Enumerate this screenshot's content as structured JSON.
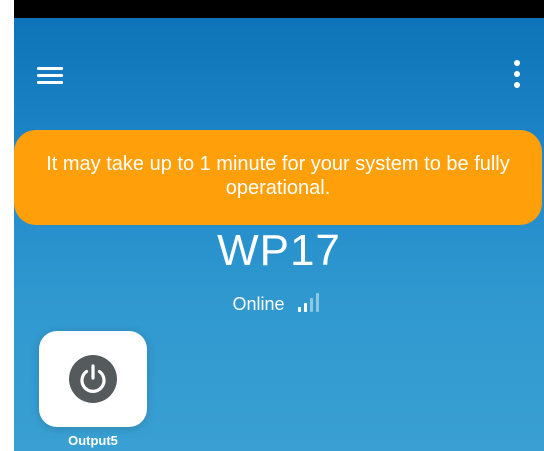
{
  "colors": {
    "background_top": "#0b72b7",
    "background_bottom": "#3aa0d3",
    "toast": "#ff9f0a",
    "power_icon_bg": "#555a5d",
    "signal_active": "#ffffff",
    "signal_inactive": "#8fc6e6"
  },
  "appbar": {
    "menu_icon": "hamburger-menu-icon",
    "overflow_icon": "more-vert-icon"
  },
  "toast": {
    "message": "It may take up to 1 minute for your system to be fully operational."
  },
  "device": {
    "name": "WP17",
    "status": "Online",
    "signal_icon": "signal-strength-icon",
    "signal_bars_active": 2,
    "signal_bars_total": 4
  },
  "outputs": [
    {
      "label": "Output5",
      "icon": "power-icon"
    }
  ]
}
